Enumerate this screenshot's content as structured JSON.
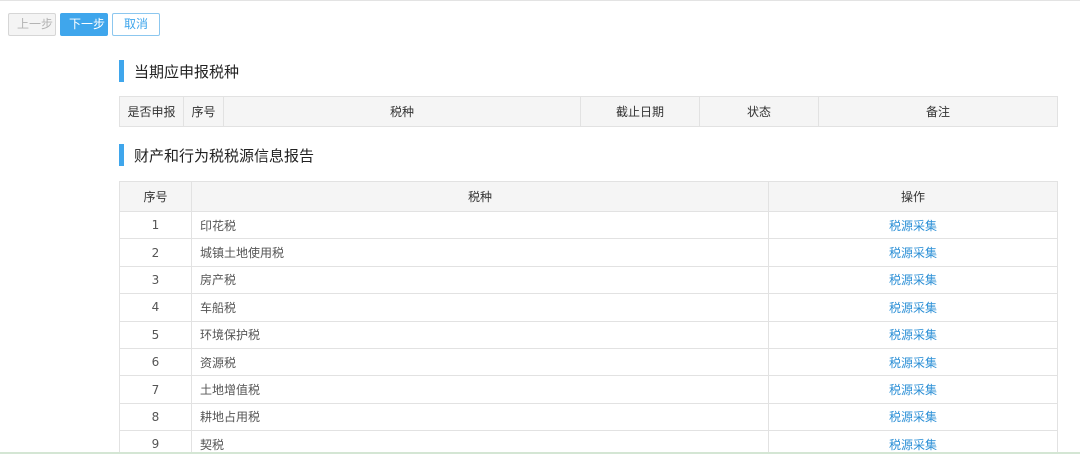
{
  "toolbar": {
    "prev_label": "上一步",
    "next_label": "下一步",
    "cancel_label": "取消"
  },
  "section1": {
    "title": "当期应申报税种",
    "columns": [
      "是否申报",
      "序号",
      "税种",
      "截止日期",
      "状态",
      "备注"
    ]
  },
  "section2": {
    "title": "财产和行为税税源信息报告",
    "columns": [
      "序号",
      "税种",
      "操作"
    ],
    "rows": [
      {
        "no": "1",
        "tax": "印花税",
        "action": "税源采集"
      },
      {
        "no": "2",
        "tax": "城镇土地使用税",
        "action": "税源采集"
      },
      {
        "no": "3",
        "tax": "房产税",
        "action": "税源采集"
      },
      {
        "no": "4",
        "tax": "车船税",
        "action": "税源采集"
      },
      {
        "no": "5",
        "tax": "环境保护税",
        "action": "税源采集"
      },
      {
        "no": "6",
        "tax": "资源税",
        "action": "税源采集"
      },
      {
        "no": "7",
        "tax": "土地增值税",
        "action": "税源采集"
      },
      {
        "no": "8",
        "tax": "耕地占用税",
        "action": "税源采集"
      },
      {
        "no": "9",
        "tax": "契税",
        "action": "税源采集"
      }
    ]
  }
}
